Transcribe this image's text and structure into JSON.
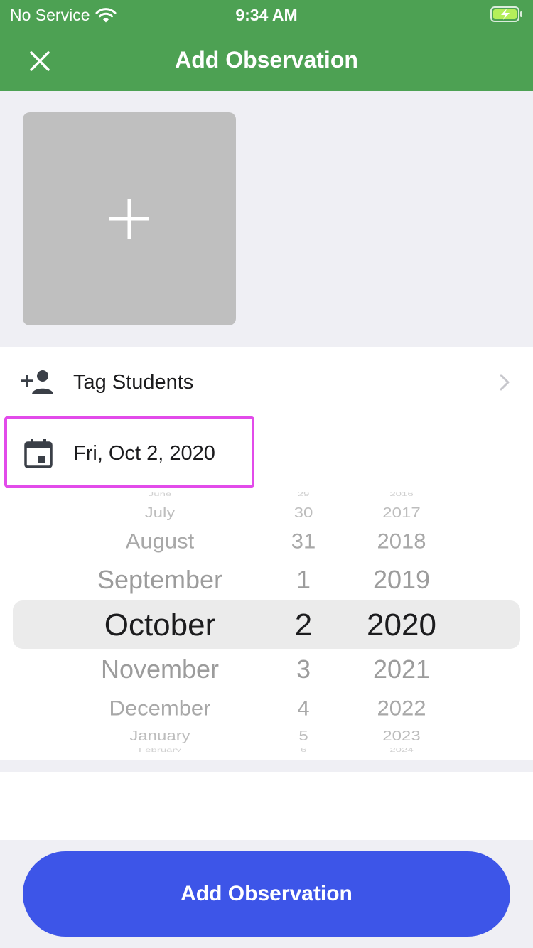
{
  "status_bar": {
    "carrier": "No Service",
    "time": "9:34 AM"
  },
  "nav": {
    "title": "Add Observation"
  },
  "rows": {
    "tag_students": "Tag Students",
    "date": "Fri, Oct 2, 2020"
  },
  "picker": {
    "months": [
      "June",
      "July",
      "August",
      "September",
      "October",
      "November",
      "December",
      "January",
      "February"
    ],
    "days": [
      "29",
      "30",
      "31",
      "1",
      "2",
      "3",
      "4",
      "5",
      "6"
    ],
    "years": [
      "2016",
      "2017",
      "2018",
      "2019",
      "2020",
      "2021",
      "2022",
      "2023",
      "2024"
    ],
    "selected": {
      "month": "October",
      "day": "2",
      "year": "2020"
    }
  },
  "footer": {
    "button_label": "Add Observation"
  },
  "colors": {
    "header": "#4da153",
    "button": "#3d55e8",
    "highlight": "#e24bea"
  }
}
